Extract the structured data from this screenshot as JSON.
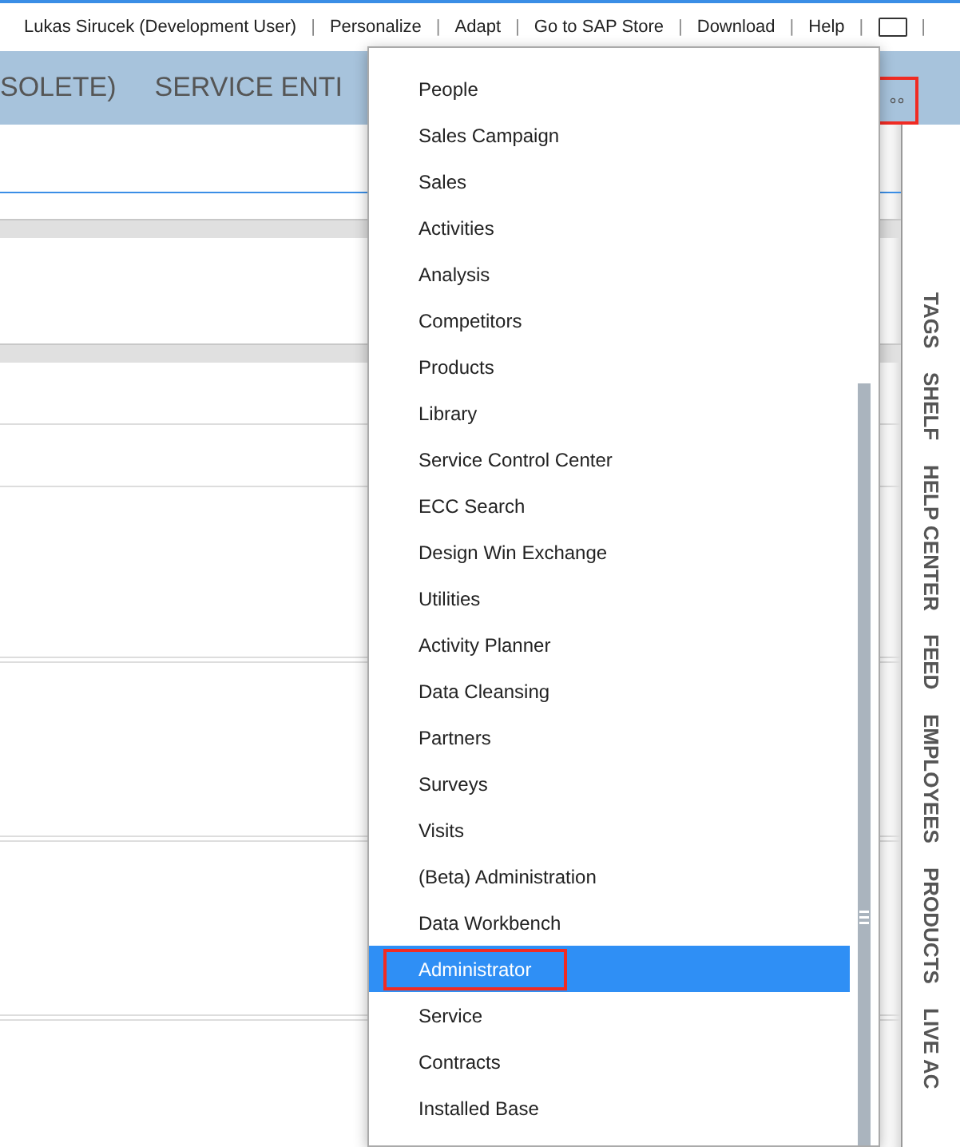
{
  "top_bar": {
    "items": [
      {
        "kind": "link",
        "text": "Lukas Sirucek (Development User)"
      },
      {
        "kind": "separator",
        "text": "|"
      },
      {
        "kind": "link",
        "text": "Personalize"
      },
      {
        "kind": "separator",
        "text": "|"
      },
      {
        "kind": "link",
        "text": "Adapt"
      },
      {
        "kind": "separator",
        "text": "|"
      },
      {
        "kind": "link",
        "text": "Go to SAP Store"
      },
      {
        "kind": "separator",
        "text": "|"
      },
      {
        "kind": "link",
        "text": "Download"
      },
      {
        "kind": "separator",
        "text": "|"
      },
      {
        "kind": "link",
        "text": "Help"
      },
      {
        "kind": "separator",
        "text": "|"
      },
      {
        "kind": "screen_icon"
      },
      {
        "kind": "separator",
        "text": "|"
      }
    ]
  },
  "nav": {
    "tabs": [
      "SOLETE)",
      "SERVICE ENTI"
    ],
    "more_button": {
      "annotated": true
    }
  },
  "menu": {
    "items": [
      {
        "label": "People",
        "selected": false,
        "annotated": false
      },
      {
        "label": "Sales Campaign",
        "selected": false,
        "annotated": false
      },
      {
        "label": "Sales",
        "selected": false,
        "annotated": false
      },
      {
        "label": "Activities",
        "selected": false,
        "annotated": false
      },
      {
        "label": "Analysis",
        "selected": false,
        "annotated": false
      },
      {
        "label": "Competitors",
        "selected": false,
        "annotated": false
      },
      {
        "label": "Products",
        "selected": false,
        "annotated": false
      },
      {
        "label": "Library",
        "selected": false,
        "annotated": false
      },
      {
        "label": "Service Control Center",
        "selected": false,
        "annotated": false
      },
      {
        "label": "ECC Search",
        "selected": false,
        "annotated": false
      },
      {
        "label": "Design Win Exchange",
        "selected": false,
        "annotated": false
      },
      {
        "label": "Utilities",
        "selected": false,
        "annotated": false
      },
      {
        "label": "Activity Planner",
        "selected": false,
        "annotated": false
      },
      {
        "label": "Data Cleansing",
        "selected": false,
        "annotated": false
      },
      {
        "label": "Partners",
        "selected": false,
        "annotated": false
      },
      {
        "label": "Surveys",
        "selected": false,
        "annotated": false
      },
      {
        "label": "Visits",
        "selected": false,
        "annotated": false
      },
      {
        "label": "(Beta) Administration",
        "selected": false,
        "annotated": false
      },
      {
        "label": "Data Workbench",
        "selected": false,
        "annotated": false
      },
      {
        "label": "Administrator",
        "selected": true,
        "annotated": true
      },
      {
        "label": "Service",
        "selected": false,
        "annotated": false
      },
      {
        "label": "Contracts",
        "selected": false,
        "annotated": false
      },
      {
        "label": "Installed Base",
        "selected": false,
        "annotated": false
      }
    ]
  },
  "side_tabs": [
    "TAGS",
    "SHELF",
    "HELP CENTER",
    "FEED",
    "EMPLOYEES",
    "PRODUCTS",
    "LIVE AC"
  ]
}
